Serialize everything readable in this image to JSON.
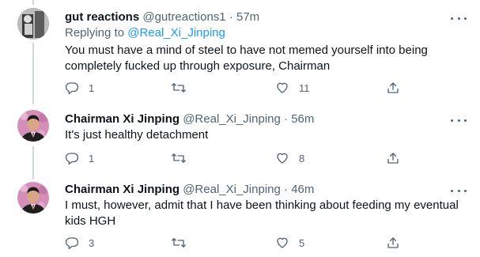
{
  "tweets": [
    {
      "name": "gut reactions",
      "handle": "@gutreactions1",
      "time": "57m",
      "replying_label": "Replying to ",
      "replying_to": "@Real_Xi_Jinping",
      "text": "You must have a mind of steel to have not memed yourself into being completely fucked up through exposure, Chairman",
      "replies": "1",
      "retweets": "",
      "likes": "11"
    },
    {
      "name": "Chairman Xi Jinping",
      "handle": "@Real_Xi_Jinping",
      "time": "56m",
      "text": "It's just healthy detachment",
      "replies": "1",
      "retweets": "",
      "likes": "8"
    },
    {
      "name": "Chairman Xi Jinping",
      "handle": "@Real_Xi_Jinping",
      "time": "46m",
      "text": "I must, however, admit that I have been thinking about feeding my eventual kids HGH",
      "replies": "3",
      "retweets": "",
      "likes": "5"
    }
  ],
  "separator": "·",
  "icons": {
    "reply": "reply-icon",
    "retweet": "retweet-icon",
    "like": "heart-icon",
    "share": "share-icon",
    "more": "more-options-icon"
  },
  "colors": {
    "text": "#0f1419",
    "muted": "#536471",
    "link": "#1d9bf0",
    "thread_line": "#cfd9de"
  }
}
